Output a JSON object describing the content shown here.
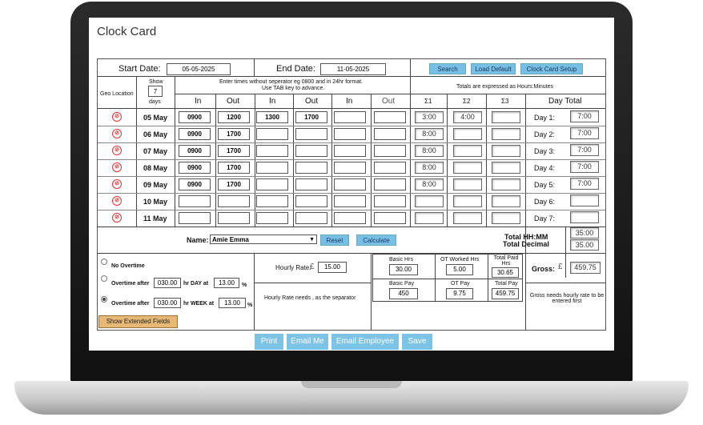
{
  "app_title": "Clock Card",
  "header": {
    "start_label": "Start Date:",
    "start_value": "05-05-2025",
    "end_label": "End Date:",
    "end_value": "11-05-2025",
    "search": "Search",
    "load_default": "Load Default",
    "setup": "Clock Card Setup"
  },
  "columns": {
    "geo": "Geo Location",
    "show": "Show",
    "show_days": "7",
    "days": "days",
    "instructions_1": "Enter times without seperator eg 0800 and in 24hr format.",
    "instructions_2": "Use TAB key to advance.",
    "totals_note": "Totals are expressed as Hours:Minutes",
    "in1": "In",
    "out1": "Out",
    "in2": "In",
    "out2": "Out",
    "in3": "In",
    "out3": "Out",
    "sum1": "Σ1",
    "sum2": "Σ2",
    "sum3": "Σ3",
    "day_total": "Day Total"
  },
  "rows": [
    {
      "date": "05 May",
      "in1": "0900",
      "out1": "1200",
      "in2": "1300",
      "out2": "1700",
      "s1": "3:00",
      "s2": "4:00",
      "day": "Day 1:",
      "total": "7:00"
    },
    {
      "date": "06 May",
      "in1": "0900",
      "out1": "1700",
      "in2": "",
      "out2": "",
      "s1": "8:00",
      "s2": "",
      "day": "Day 2:",
      "total": "7:00"
    },
    {
      "date": "07 May",
      "in1": "0900",
      "out1": "1700",
      "in2": "",
      "out2": "",
      "s1": "8:00",
      "s2": "",
      "day": "Day 3:",
      "total": "7:00"
    },
    {
      "date": "08 May",
      "in1": "0900",
      "out1": "1700",
      "in2": "",
      "out2": "",
      "s1": "8:00",
      "s2": "",
      "day": "Day 4:",
      "total": "7:00"
    },
    {
      "date": "09 May",
      "in1": "0900",
      "out1": "1700",
      "in2": "",
      "out2": "",
      "s1": "8:00",
      "s2": "",
      "day": "Day 5:",
      "total": "7:00"
    },
    {
      "date": "10 May",
      "in1": "",
      "out1": "",
      "in2": "",
      "out2": "",
      "s1": "",
      "s2": "",
      "day": "Day 6:",
      "total": ""
    },
    {
      "date": "11 May",
      "in1": "",
      "out1": "",
      "in2": "",
      "out2": "",
      "s1": "",
      "s2": "",
      "day": "Day 7:",
      "total": ""
    }
  ],
  "name_row": {
    "name_label": "Name:",
    "name_value": "Amie Emma",
    "reset": "Reset",
    "calculate": "Calculate",
    "total_hhmm_label": "Total HH:MM",
    "total_decimal_label": "Total Decimal",
    "total_hhmm": "35:00",
    "total_decimal": "35.00"
  },
  "overtime": {
    "no_overtime": "No Overtime",
    "after_label": "Overtime after",
    "day_hours": "030.00",
    "hr_day_at": "hr DAY at",
    "day_pct": "13.00",
    "pct": "%",
    "week_hours": "030.00",
    "hr_week_at": "hr WEEK at",
    "week_pct": "13.00",
    "show_extended": "Show Extended Fields"
  },
  "rate": {
    "label": "Hourly Rate:",
    "currency": "£",
    "value": "15.00",
    "note": "Hourly Rate needs , as the separator"
  },
  "pay": {
    "basic_hrs_label": "Basic Hrs",
    "basic_hrs": "30.00",
    "ot_worked_label": "OT Worked Hrs",
    "ot_worked": "5.00",
    "total_paid_label": "Total Paid Hrs",
    "total_paid": "30.65",
    "basic_pay_label": "Basic Pay",
    "basic_pay": "450",
    "ot_pay_label": "OT Pay",
    "ot_pay": "9.75",
    "total_pay_label": "Total Pay",
    "total_pay": "459.75",
    "gross_label": "Gross:",
    "gross_currency": "£",
    "gross": "459.75",
    "gross_note": "Gross needs hourly rate to be entered first"
  },
  "footer": {
    "print": "Print",
    "email_me": "Email Me",
    "email_employee": "Email Employee",
    "save": "Save"
  }
}
